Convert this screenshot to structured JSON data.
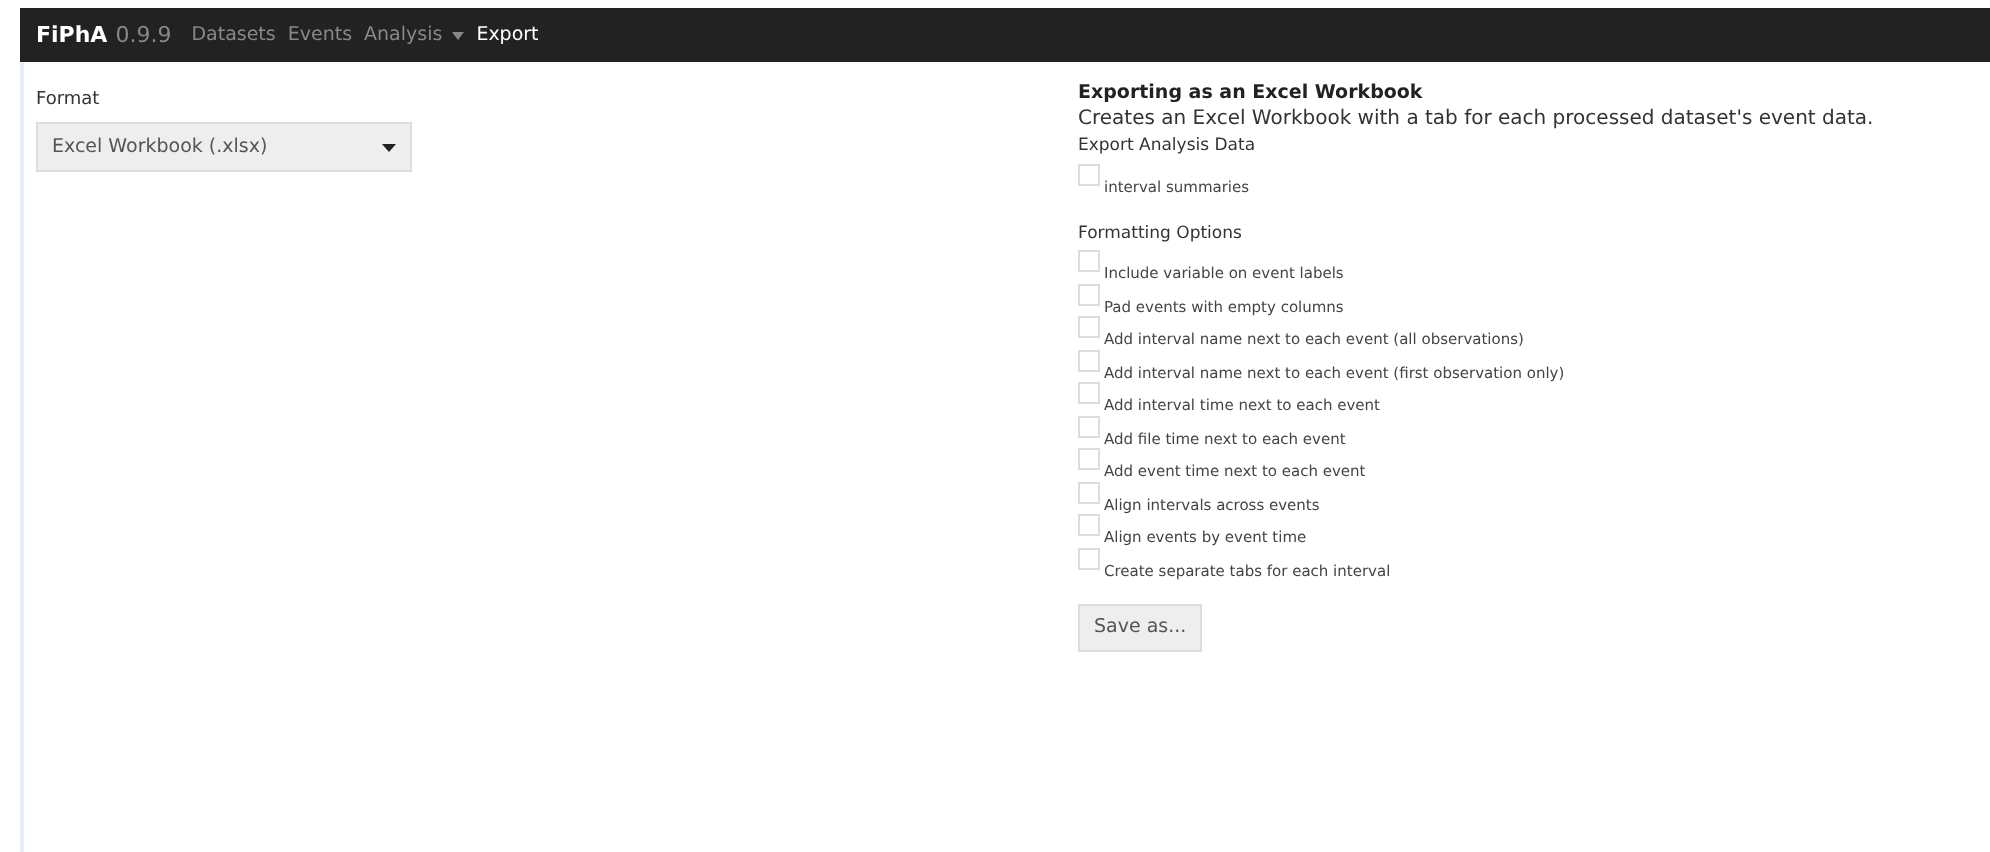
{
  "navbar": {
    "brand": "FiPhA",
    "version": "0.9.9",
    "items": [
      {
        "label": "Datasets",
        "selected": false,
        "dropdown": false
      },
      {
        "label": "Events",
        "selected": false,
        "dropdown": false
      },
      {
        "label": "Analysis",
        "selected": false,
        "dropdown": true
      },
      {
        "label": "Export",
        "selected": true,
        "dropdown": false
      }
    ]
  },
  "format": {
    "label": "Format",
    "value": "Excel Workbook (.xlsx)"
  },
  "export": {
    "title": "Exporting as an Excel Workbook",
    "description": "Creates an Excel Workbook with a tab for each processed dataset's event data.",
    "sections": [
      {
        "label": "Export Analysis Data",
        "options": [
          {
            "label": "interval summaries",
            "checked": false
          }
        ]
      },
      {
        "label": "Formatting Options",
        "options": [
          {
            "label": "Include variable on event labels",
            "checked": false
          },
          {
            "label": "Pad events with empty columns",
            "checked": false
          },
          {
            "label": "Add interval name next to each event (all observations)",
            "checked": false
          },
          {
            "label": "Add interval name next to each event (first observation only)",
            "checked": false
          },
          {
            "label": "Add interval time next to each event",
            "checked": false
          },
          {
            "label": "Add file time next to each event",
            "checked": false
          },
          {
            "label": "Add event time next to each event",
            "checked": false
          },
          {
            "label": "Align intervals across events",
            "checked": false
          },
          {
            "label": "Align events by event time",
            "checked": false
          },
          {
            "label": "Create separate tabs for each interval",
            "checked": false
          }
        ]
      }
    ],
    "button": "Save as..."
  }
}
